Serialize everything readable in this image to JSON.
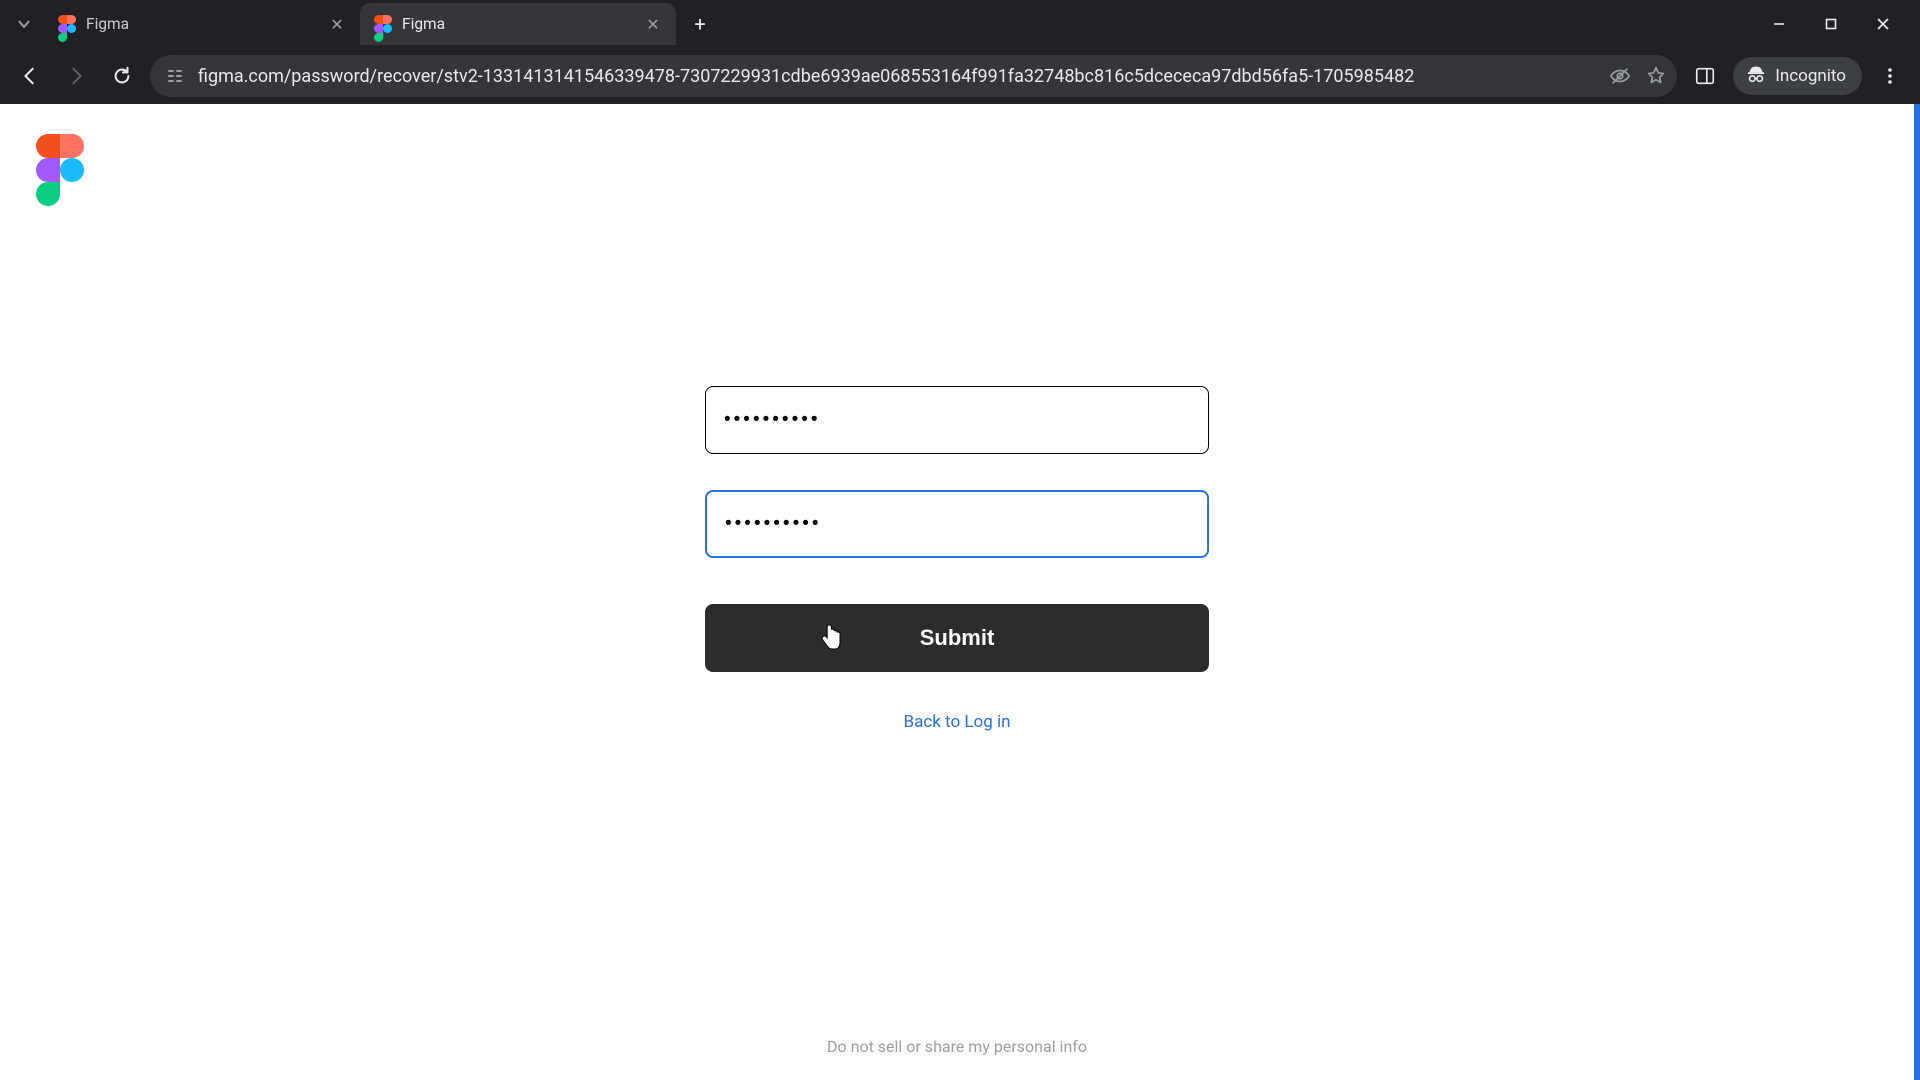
{
  "browser": {
    "tabs": [
      {
        "title": "Figma",
        "active": false
      },
      {
        "title": "Figma",
        "active": true
      }
    ],
    "url": "figma.com/password/recover/stv2-1331413141546339478-7307229931cdbe6939ae068553164f991fa32748bc816c5dcececa97dbd56fa5-1705985482",
    "incognito_label": "Incognito"
  },
  "form": {
    "password1_value": "••••••••••",
    "password2_value": "••••••••••",
    "submit_label": "Submit",
    "back_link_label": "Back to Log in"
  },
  "footer": {
    "do_not_sell": "Do not sell or share my personal info"
  }
}
